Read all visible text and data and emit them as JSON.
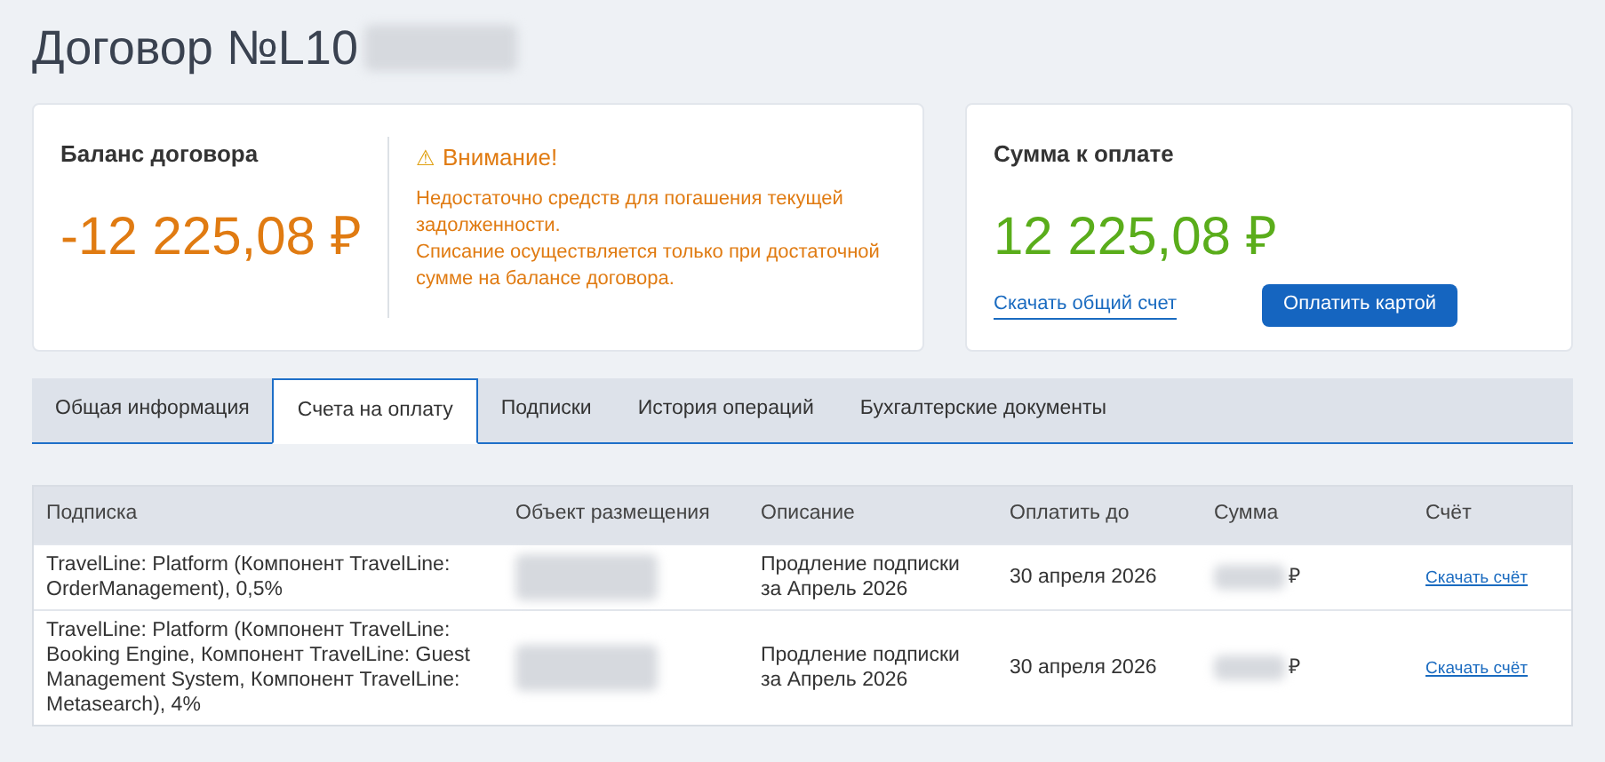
{
  "title": "Договор №L10",
  "balance": {
    "label": "Баланс договора",
    "amount": "-12 225,08 ₽",
    "warning_icon": "⚠",
    "warning_title": "Внимание!",
    "warning_lines": [
      "Недостаточно средств для погашения текущей задолженности.",
      "Списание осуществляется только при достаточной сумме на балансе договора."
    ]
  },
  "payment": {
    "label": "Сумма к оплате",
    "amount": "12 225,08 ₽",
    "link": "Скачать общий счет",
    "button": "Оплатить картой"
  },
  "tabs": [
    {
      "label": "Общая информация",
      "selected": false
    },
    {
      "label": "Счета на оплату",
      "selected": true
    },
    {
      "label": "Подписки",
      "selected": false
    },
    {
      "label": "История операций",
      "selected": false
    },
    {
      "label": "Бухгалтерские документы",
      "selected": false
    }
  ],
  "table": {
    "columns": [
      "Подписка",
      "Объект размещения",
      "Описание",
      "Оплатить до",
      "Сумма",
      "Счёт"
    ],
    "rows": [
      {
        "subscription": "TravelLine: Platform (Компонент TravelLine: OrderManagement), 0,5%",
        "description": "Продление подписки за Апрель 2026",
        "due": "30 апреля 2026",
        "currency": "₽",
        "invoice": "Скачать счёт"
      },
      {
        "subscription": "TravelLine: Platform (Компонент TravelLine: Booking Engine, Компонент TravelLine: Guest Management System, Компонент TravelLine: Metasearch), 4%",
        "description": "Продление подписки за Апрель 2026",
        "due": "30 апреля 2026",
        "currency": "₽",
        "invoice": "Скачать счёт"
      }
    ]
  }
}
